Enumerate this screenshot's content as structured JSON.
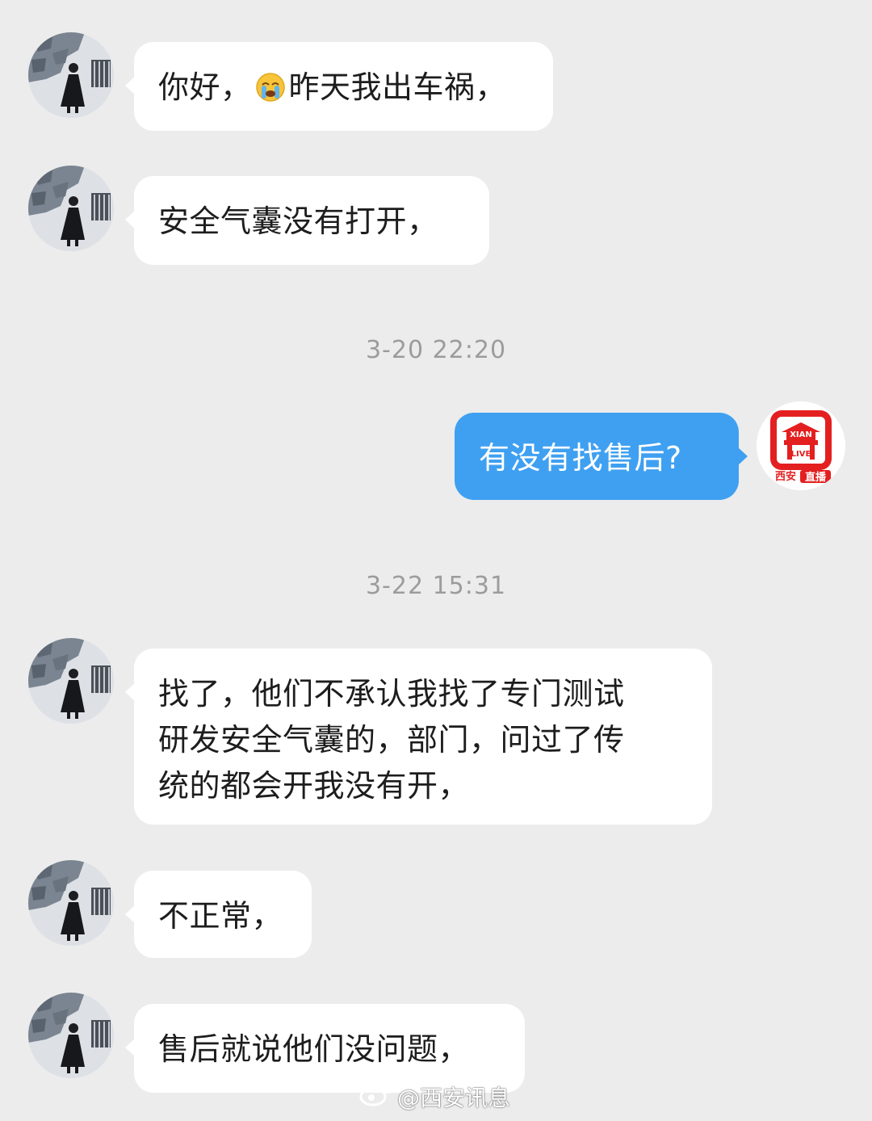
{
  "messages": [
    {
      "sender": "other",
      "text_before_emoji": "你好，",
      "emoji": "crying-face",
      "text_after_emoji": "昨天我出车祸，"
    },
    {
      "sender": "other",
      "text": "安全气囊没有打开，"
    },
    {
      "sender": "self",
      "text": "有没有找售后?"
    },
    {
      "sender": "other",
      "lines": [
        "找了，他们不承认我找了专门测试",
        "研发安全气囊的，部门，问过了传",
        "统的都会开我没有开，"
      ]
    },
    {
      "sender": "other",
      "text": "不正常，"
    },
    {
      "sender": "other",
      "text": "售后就说他们没问题，"
    }
  ],
  "timestamps": [
    "3-20 22:20",
    "3-22 15:31"
  ],
  "station_logo": {
    "line1": "XIAN",
    "line2": "LIVE",
    "caption_left": "西安",
    "caption_right": "直播"
  },
  "watermark": {
    "text": "@西安讯息"
  },
  "colors": {
    "background": "#ececec",
    "incoming_bubble": "#ffffff",
    "outgoing_bubble": "#3fa0f1",
    "timestamp": "#9c9c9c",
    "logo_red": "#e41f1f"
  }
}
